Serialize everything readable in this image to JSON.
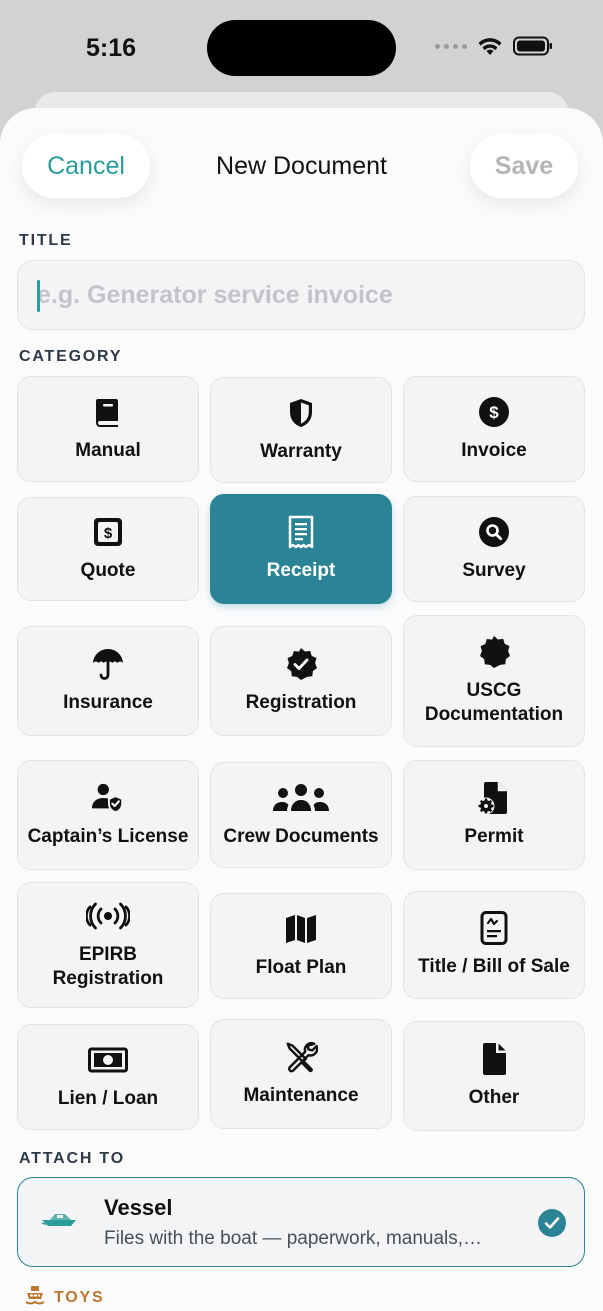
{
  "status": {
    "time": "5:16"
  },
  "nav": {
    "cancel": "Cancel",
    "title": "New Document",
    "save": "Save"
  },
  "title_section": {
    "label": "TITLE",
    "placeholder": "e.g. Generator service invoice"
  },
  "category_section": {
    "label": "CATEGORY",
    "selected": "Receipt",
    "items": [
      {
        "label": "Manual",
        "icon": "book-icon"
      },
      {
        "label": "Warranty",
        "icon": "shield-icon"
      },
      {
        "label": "Invoice",
        "icon": "dollar-circle-icon"
      },
      {
        "label": "Quote",
        "icon": "dollar-square-icon"
      },
      {
        "label": "Receipt",
        "icon": "receipt-icon"
      },
      {
        "label": "Survey",
        "icon": "search-circle-icon"
      },
      {
        "label": "Insurance",
        "icon": "umbrella-icon"
      },
      {
        "label": "Registration",
        "icon": "checkmark-seal-icon"
      },
      {
        "label": "USCG Documentation",
        "icon": "seal-icon"
      },
      {
        "label": "Captain’s License",
        "icon": "person-badge-icon"
      },
      {
        "label": "Crew Documents",
        "icon": "group-icon"
      },
      {
        "label": "Permit",
        "icon": "document-gear-icon"
      },
      {
        "label": "EPIRB Registration",
        "icon": "radio-signal-icon"
      },
      {
        "label": "Float Plan",
        "icon": "map-icon"
      },
      {
        "label": "Title / Bill of Sale",
        "icon": "document-signature-icon"
      },
      {
        "label": "Lien / Loan",
        "icon": "banknote-icon"
      },
      {
        "label": "Maintenance",
        "icon": "wrench-screwdriver-icon"
      },
      {
        "label": "Other",
        "icon": "document-icon"
      }
    ]
  },
  "attach_section": {
    "label": "ATTACH TO",
    "option": {
      "title": "Vessel",
      "subtitle": "Files with the boat — paperwork, manuals,…",
      "icon": "boat-icon",
      "checked": true
    }
  },
  "toys_section": {
    "label": "TOYS",
    "icon": "ferry-icon"
  },
  "colors": {
    "accent": "#2b8496",
    "cancel": "#2a9d9a",
    "toys": "#b9772f"
  }
}
